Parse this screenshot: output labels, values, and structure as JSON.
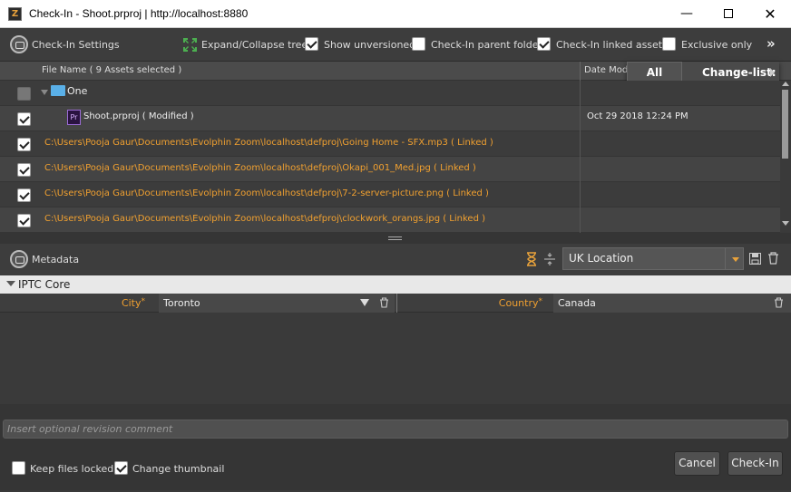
{
  "window": {
    "title": "Check-In - Shoot.prproj | http://localhost:8880",
    "app_icon": "Z"
  },
  "toolbar": {
    "section_title": "Check-In Settings",
    "expand_label": "Expand/Collapse tree",
    "options": [
      {
        "label": "Show unversioned",
        "checked": true
      },
      {
        "label": "Check-In parent folder",
        "checked": false
      },
      {
        "label": "Check-In linked assets",
        "checked": true
      },
      {
        "label": "Exclusive only",
        "checked": false
      }
    ],
    "more_glyph": "»"
  },
  "list": {
    "col_filename": "File Name ( 9 Assets selected )",
    "col_date": "Date Modi",
    "folder": {
      "name": "One"
    },
    "project": {
      "badge": "Pr",
      "name": "Shoot.prproj ( Modified )",
      "date": "Oct 29 2018 12:24 PM"
    },
    "linked": [
      "C:\\Users\\Pooja Gaur\\Documents\\Evolphin Zoom\\localhost\\defproj\\Going Home - SFX.mp3 ( Linked )",
      "C:\\Users\\Pooja Gaur\\Documents\\Evolphin Zoom\\localhost\\defproj\\Okapi_001_Med.jpg ( Linked )",
      "C:\\Users\\Pooja Gaur\\Documents\\Evolphin Zoom\\localhost\\defproj\\7-2-server-picture.png ( Linked )",
      "C:\\Users\\Pooja Gaur\\Documents\\Evolphin Zoom\\localhost\\defproj\\clockwork_orangs.jpg ( Linked )"
    ]
  },
  "changelist": {
    "all_label": "All",
    "label": "Change-list:"
  },
  "metadata": {
    "title": "Metadata",
    "template": "UK Location",
    "section": "IPTC Core",
    "fields": [
      {
        "label": "City",
        "required": "*",
        "value": "Toronto"
      },
      {
        "label": "Country",
        "required": "*",
        "value": "Canada"
      }
    ]
  },
  "footer": {
    "comment_placeholder": "Insert optional revision comment",
    "keep_locked_label": "Keep files locked",
    "keep_locked_checked": false,
    "change_thumb_label": "Change thumbnail",
    "change_thumb_checked": true,
    "cancel_label": "Cancel",
    "checkin_label": "Check-In"
  },
  "colors": {
    "accent": "#f0a030",
    "background": "#3a3a3a",
    "row_alt": "#444444"
  }
}
